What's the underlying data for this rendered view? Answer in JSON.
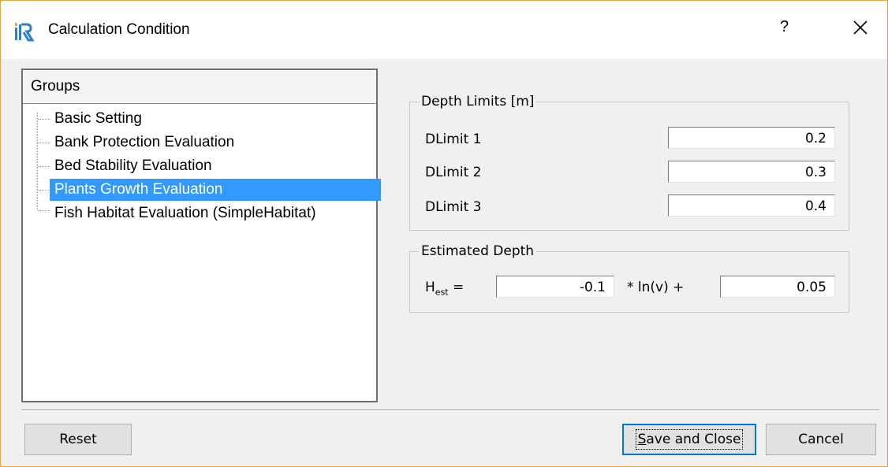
{
  "window": {
    "title": "Calculation Condition",
    "help_glyph": "?",
    "close_glyph": "✕",
    "accent": "#3399ff",
    "default_button_border": "#0078d7"
  },
  "groups": {
    "header": "Groups",
    "items": [
      {
        "label": "Basic Setting"
      },
      {
        "label": "Bank Protection Evaluation"
      },
      {
        "label": "Bed Stability Evaluation"
      },
      {
        "label": "Plants Growth Evaluation",
        "selected": true
      },
      {
        "label": "Fish Habitat Evaluation (SimpleHabitat)"
      }
    ]
  },
  "depth_limits": {
    "title": "Depth Limits [m]",
    "rows": [
      {
        "label": "DLimit 1",
        "value": "0.2"
      },
      {
        "label": "DLimit 2",
        "value": "0.3"
      },
      {
        "label": "DLimit 3",
        "value": "0.4"
      }
    ]
  },
  "estimated_depth": {
    "title": "Estimated Depth",
    "h_label": "H",
    "h_sub": "est",
    "equals": "=",
    "coef_value": "-0.1",
    "operator_text": "* ln(v) +",
    "const_value": "0.05"
  },
  "buttons": {
    "reset": "Reset",
    "save_close_underline": "S",
    "save_close_rest": "ave and Close",
    "cancel": "Cancel"
  }
}
